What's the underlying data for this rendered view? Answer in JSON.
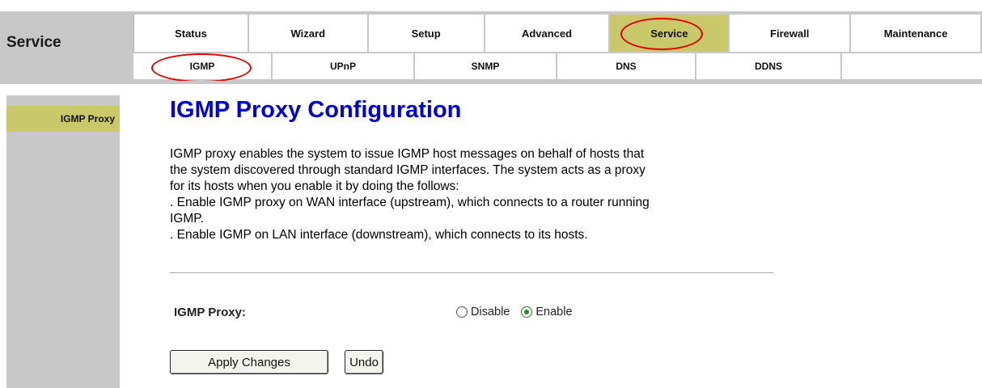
{
  "header": {
    "section_label": "Service",
    "main_tabs": [
      {
        "label": "Status"
      },
      {
        "label": "Wizard"
      },
      {
        "label": "Setup"
      },
      {
        "label": "Advanced"
      },
      {
        "label": "Service",
        "active": true
      },
      {
        "label": "Firewall"
      },
      {
        "label": "Maintenance"
      }
    ],
    "sub_tabs": [
      {
        "label": "IGMP",
        "active": true
      },
      {
        "label": "UPnP"
      },
      {
        "label": "SNMP"
      },
      {
        "label": "DNS"
      },
      {
        "label": "DDNS"
      },
      {
        "label": ""
      }
    ]
  },
  "sidebar": {
    "items": [
      {
        "label": "IGMP Proxy",
        "active": true
      }
    ]
  },
  "main": {
    "title": "IGMP Proxy Configuration",
    "description_lines": [
      "IGMP proxy enables the system to issue IGMP host messages on behalf of hosts that",
      "the system discovered through standard IGMP interfaces. The system acts as a proxy",
      "for its hosts when you enable it by doing the follows:",
      ". Enable IGMP proxy on WAN interface (upstream), which connects to a router running",
      "IGMP.",
      ". Enable IGMP on LAN interface (downstream), which connects to its hosts."
    ],
    "form": {
      "igmp_proxy_label": "IGMP Proxy:",
      "options": [
        {
          "label": "Disable",
          "checked": false
        },
        {
          "label": "Enable",
          "checked": true
        }
      ]
    },
    "buttons": {
      "apply": "Apply Changes",
      "undo": "Undo"
    }
  },
  "colors": {
    "highlight": "#c9c86b",
    "gray_frame": "#c8c8c8",
    "title_blue": "#0000dd",
    "annotation_red": "#e00000",
    "radio_green": "#2a8a2a"
  }
}
